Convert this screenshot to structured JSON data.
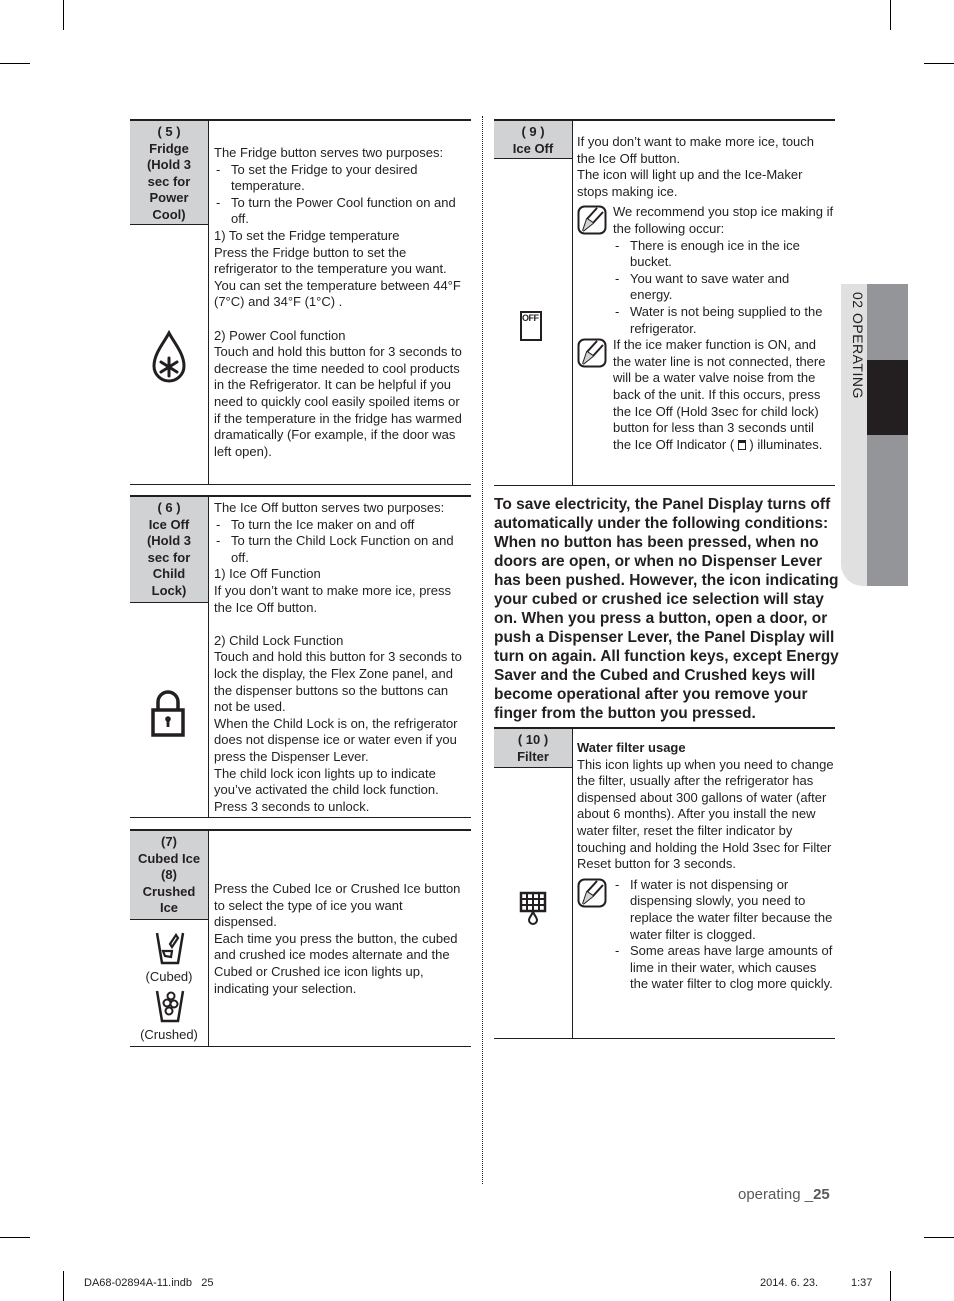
{
  "section_tab": {
    "label": "02  OPERATING"
  },
  "left_column": {
    "rows": [
      {
        "header": [
          "( 5 )",
          "Fridge",
          "(Hold 3",
          "sec for",
          "Power",
          "Cool)"
        ],
        "icon": "power-cool-drop-icon",
        "intro": "The Fridge button serves two purposes:",
        "bullets": [
          "To set the Fridge to your desired temperature.",
          "To turn the Power Cool function on and off."
        ],
        "sections": [
          {
            "title": "1) To set the Fridge temperature",
            "body": "Press the Fridge button to set the refrigerator to the temperature you want. You can set the temperature between 44°F (7°C) and 34°F (1°C) ."
          },
          {
            "title": "2) Power Cool function",
            "body": "Touch and hold this button for 3 seconds to decrease the time needed to cool products in the Refrigerator. It can be helpful if you need to quickly cool easily spoiled items or if the temperature in the fridge has warmed dramatically (For example, if the door was left open)."
          }
        ]
      },
      {
        "header": [
          "( 6 )",
          "Ice Off",
          "(Hold 3",
          "sec for",
          "Child",
          "Lock)"
        ],
        "icon": "child-lock-padlock-icon",
        "intro": "The Ice Off button serves two purposes:",
        "bullets": [
          "To turn the Ice maker on and off",
          "To turn the Child Lock Function on and off."
        ],
        "sections": [
          {
            "title": "1) Ice Off Function",
            "body": "If you don’t want to make more ice, press the Ice Off button."
          },
          {
            "title": "2) Child Lock Function",
            "body": "Touch and hold this button for 3 seconds to lock the display, the Flex Zone panel, and the dispenser buttons so the buttons can not be used.",
            "body2": "When the Child Lock is on, the refrigerator does not dispense ice or water even if you press the Dispenser Lever.",
            "body3": "The child lock icon lights up to indicate you’ve activated the child lock function.",
            "body4": "Press 3 seconds to unlock."
          }
        ]
      },
      {
        "header": [
          "(7)",
          "Cubed Ice",
          "(8)",
          "Crushed",
          "Ice"
        ],
        "icons": [
          {
            "name": "cubed-ice-icon",
            "caption": "(Cubed)"
          },
          {
            "name": "crushed-ice-icon",
            "caption": "(Crushed)"
          }
        ],
        "body": "Press the Cubed Ice or Crushed Ice button to select the type of ice you want dispensed.",
        "body2": "Each time you press the button, the cubed and crushed ice modes alternate and the Cubed or Crushed ice icon lights up, indicating your selection."
      }
    ]
  },
  "right_column": {
    "ice_off_row": {
      "header": [
        "( 9 )",
        "Ice Off"
      ],
      "icon": "ice-off-indicator-icon",
      "icon_text": "OFF",
      "body": "If you don’t want to make more ice, touch the Ice Off button.",
      "body2": "The icon will light up and the Ice-Maker stops making ice.",
      "note1": {
        "intro": "We recommend you stop ice making if the following occur:",
        "bullets": [
          "There is enough ice in the ice bucket.",
          "You want to save water and energy.",
          "Water is not being supplied to the refrigerator."
        ]
      },
      "note2": {
        "text_before": "If the ice maker function is ON, and the water line is not connected, there will be a water valve noise from the back of the unit. If this occurs, press the Ice Off (Hold 3sec for child lock) button for less than 3 seconds until the Ice Off Indicator (",
        "text_after": ") illuminates."
      }
    },
    "power_saving_paragraph": "To save electricity, the Panel Display turns off automatically under the following conditions: When no button has been pressed, when no doors are open, or when no Dispenser Lever has been pushed. However, the icon indicating your cubed or crushed ice selection will stay on. When you press a button, open a door, or push a Dispenser Lever, the Panel Display will turn on again. All function keys, except Energy Saver and the Cubed and Crushed keys will become operational after you remove your finger from the button you pressed.",
    "filter_row": {
      "header": [
        "( 10 )",
        "Filter"
      ],
      "icon": "water-filter-icon",
      "title": "Water filter usage",
      "body": "This icon lights up when you need to change the filter, usually after the refrigerator has dispensed about 300 gallons of water (after about 6 months). After you install the new water filter, reset the filter indicator by touching and holding the Hold 3sec for Filter Reset button for 3 seconds.",
      "note_bullets": [
        "If water is not dispensing or dispensing slowly, you need to replace the water filter because the water filter is clogged.",
        "Some areas have large amounts of lime in their water, which causes the water filter to clog more quickly."
      ]
    }
  },
  "footer": {
    "section": "operating _",
    "page": "25",
    "slug_file": "DA68-02894A-11.indb   25",
    "slug_date": "2014. 6. 23.",
    "slug_time": "1:37"
  }
}
